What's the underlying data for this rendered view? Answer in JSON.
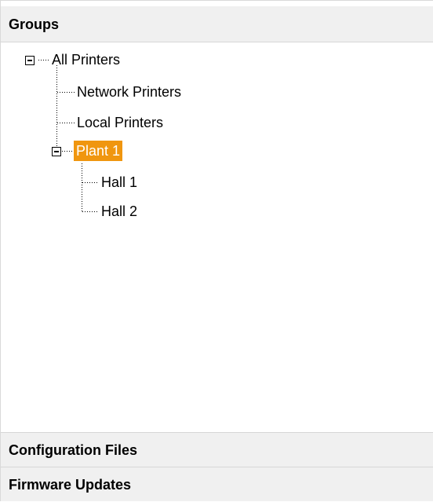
{
  "groups": {
    "title": "Groups",
    "tree": {
      "all_printers": "All Printers",
      "network_printers": "Network Printers",
      "local_printers": "Local Printers",
      "plant_1": "Plant 1",
      "hall_1": "Hall 1",
      "hall_2": "Hall 2",
      "selected": "Plant 1",
      "expanded": [
        "All Printers",
        "Plant 1"
      ]
    }
  },
  "sections": {
    "configuration_files": "Configuration Files",
    "firmware_updates": "Firmware Updates"
  },
  "colors": {
    "selection_bg": "#f0960f",
    "selection_text": "#ffffff",
    "header_bg": "#f0f0f0"
  },
  "icons": {
    "expanded_node": "minus-box-icon"
  }
}
